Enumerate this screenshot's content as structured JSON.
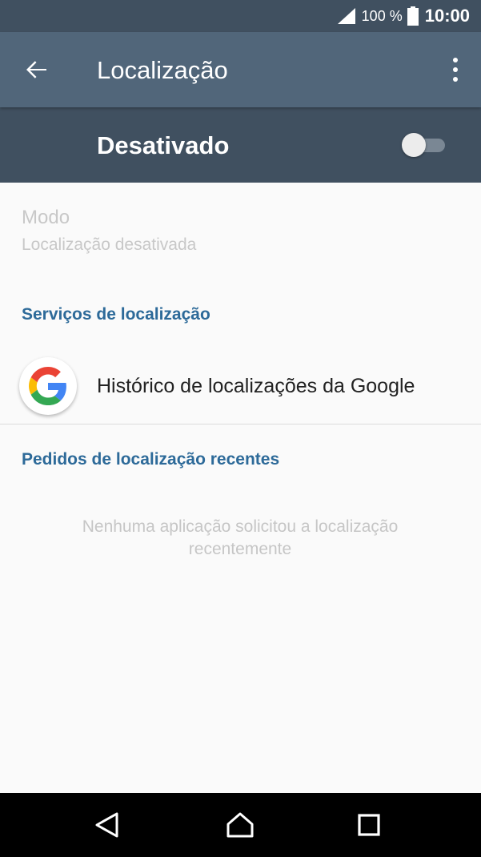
{
  "status_bar": {
    "battery_percent": "100 %",
    "time": "10:00",
    "icons": [
      "signal-icon",
      "battery-icon"
    ]
  },
  "toolbar": {
    "title": "Localização",
    "back_icon": "arrow-back-icon",
    "overflow_icon": "more-vert-icon"
  },
  "master_switch": {
    "label": "Desativado",
    "state": "off"
  },
  "mode": {
    "title": "Modo",
    "summary": "Localização desativada"
  },
  "services": {
    "header": "Serviços de localização",
    "items": [
      {
        "icon": "google-icon",
        "label": "Histórico de localizações da Google"
      }
    ]
  },
  "recent_requests": {
    "header": "Pedidos de localização recentes",
    "empty_text": "Nenhuma aplicação solicitou a localização recentemente"
  },
  "nav_bar": {
    "icons": [
      "nav-back-icon",
      "nav-home-icon",
      "nav-recents-icon"
    ]
  },
  "colors": {
    "status_bar": "#405060",
    "toolbar": "#51667a",
    "switch_bar": "#405060",
    "section_header": "#2d6a99",
    "background": "#fafafa",
    "nav_bar": "#000000"
  }
}
